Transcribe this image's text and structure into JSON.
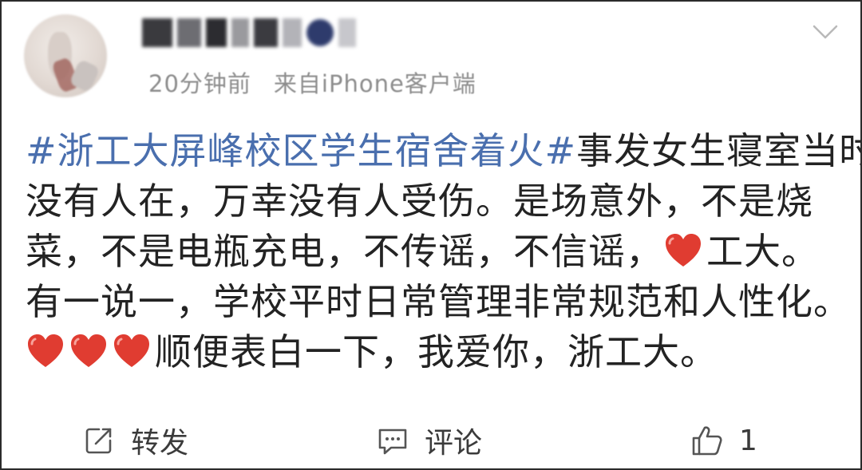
{
  "post": {
    "meta": {
      "time": "20分钟前",
      "source": "来自iPhone客户端"
    },
    "content": {
      "line1_hashtag": "#浙工大屏峰校区学生宿舍着火#",
      "line1_text": "事发女生寝室当时",
      "line2": "没有人在，万幸没有人受伤。是场意外，不是烧",
      "line3_before_heart": "菜，不是电瓶充电，不传谣，不信谣，",
      "line3_after_heart": "工大。",
      "line4": "有一说一，学校平时日常管理非常规范和人性化。",
      "line5_after_hearts": "顺便表白一下，我爱你，浙工大。"
    },
    "actions": {
      "repost_label": "转发",
      "comment_label": "评论",
      "like_count": "1"
    }
  },
  "icons": {
    "heart": "red-heart-emoji",
    "repost": "repost-icon",
    "comment": "comment-icon",
    "like": "thumbs-up-icon",
    "menu": "chevron-down-icon"
  },
  "colors": {
    "hashtag": "#4a6fae",
    "heart": "#e03c31",
    "meta_text": "#8d8d8d",
    "body_text": "#232323"
  }
}
